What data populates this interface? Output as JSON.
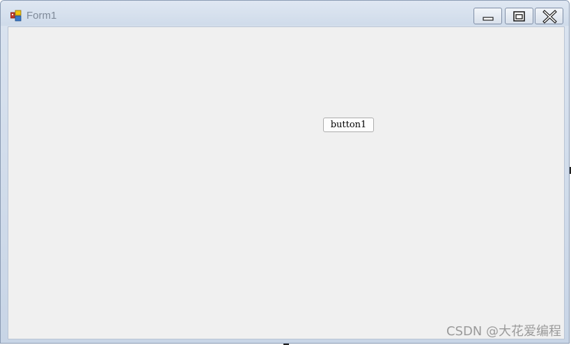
{
  "window": {
    "title": "Form1",
    "app_icon": "winforms-form-icon",
    "controls": {
      "minimize_icon": "minimize-icon",
      "maximize_icon": "maximize-icon",
      "close_icon": "close-icon"
    }
  },
  "form": {
    "button1_label": "button1"
  },
  "watermark": {
    "text": "CSDN @大花爱编程"
  },
  "colors": {
    "titlebar": "#cfdbea",
    "client_background": "#f0f0f0",
    "title_text": "#7f8a99",
    "watermark": "#9a9a9a"
  }
}
